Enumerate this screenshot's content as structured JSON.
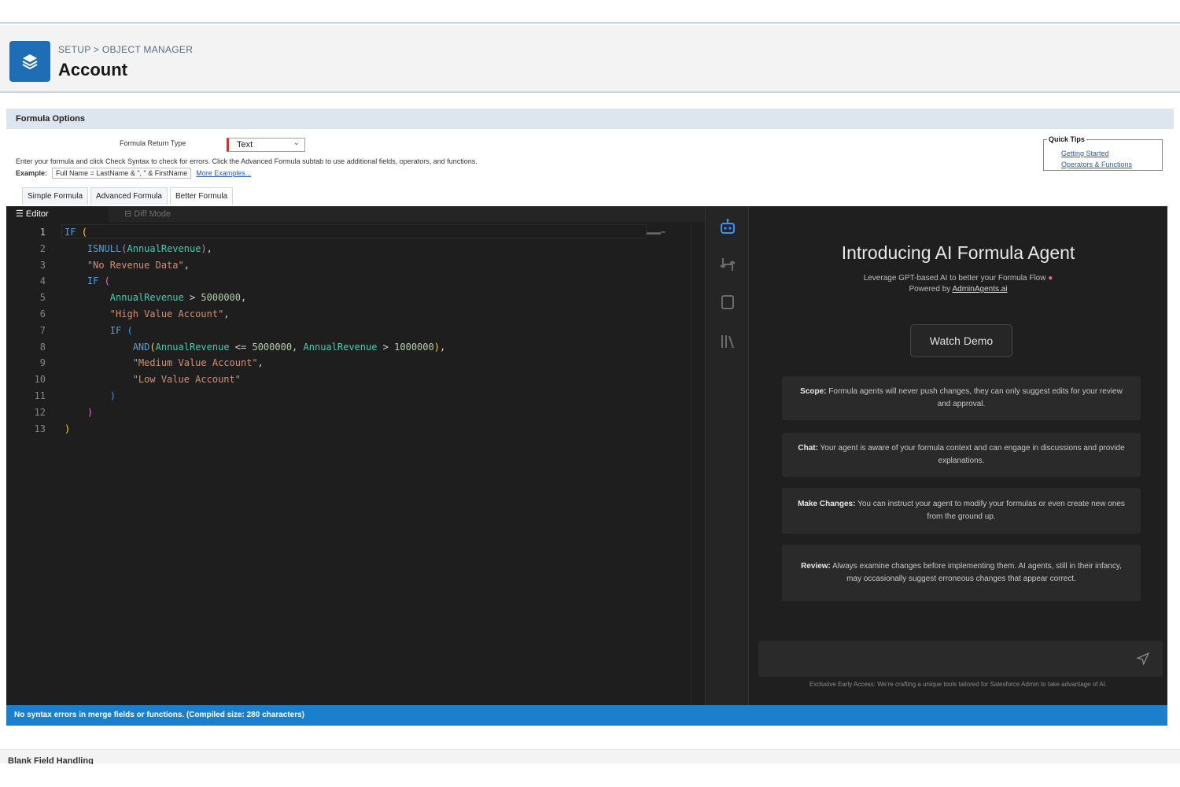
{
  "header": {
    "breadcrumb": "SETUP > OBJECT MANAGER",
    "title": "Account"
  },
  "formula_options": {
    "section_title": "Formula Options",
    "return_type_label": "Formula Return Type",
    "return_type_value": "Text",
    "instructions": "Enter your formula and click Check Syntax to check for errors. Click the Advanced Formula subtab to use additional fields, operators, and functions.",
    "example_label": "Example:",
    "example_value": "Full Name = LastName & \", \" & FirstName",
    "more_examples": "More Examples..."
  },
  "quick_tips": {
    "title": "Quick Tips",
    "links": [
      "Getting Started",
      "Operators & Functions"
    ]
  },
  "formula_tabs": [
    "Simple Formula",
    "Advanced Formula",
    "Better Formula"
  ],
  "editor": {
    "tabs": [
      "Editor",
      "Diff Mode"
    ],
    "line_numbers": [
      "1",
      "2",
      "3",
      "4",
      "5",
      "6",
      "7",
      "8",
      "9",
      "10",
      "11",
      "12",
      "13"
    ]
  },
  "agent": {
    "title": "Introducing AI Formula Agent",
    "subtitle": "Leverage GPT-based AI to better your Formula Flow",
    "powered_prefix": "Powered by ",
    "powered_link": "AdminAgents.ai",
    "watch_demo": "Watch Demo",
    "cards": [
      {
        "label": "Scope:",
        "text": "Formula agents will never push changes, they can only suggest edits for your review and approval."
      },
      {
        "label": "Chat:",
        "text": "Your agent is aware of your formula context and can engage in discussions and provide explanations."
      },
      {
        "label": "Make Changes:",
        "text": "You can instruct your agent to modify your formulas or even create new ones from the ground up."
      },
      {
        "label": "Review:",
        "text": "Always examine changes before implementing them. AI agents, still in their infancy, may occasionally suggest erroneous changes that appear correct."
      }
    ],
    "disclaimer": "Exclusive Early Access: We're crafting a unique tools tailored for Salesforce Admin to take advantage of AI."
  },
  "status": {
    "message": "No syntax errors in merge fields or functions. (Compiled size: 280 characters)"
  },
  "footer": {
    "section_title": "Blank Field Handling"
  },
  "colors": {
    "accent": "#1b7fcc",
    "header_icon": "#1f6db4",
    "editor_bg": "#1e1e1e"
  }
}
